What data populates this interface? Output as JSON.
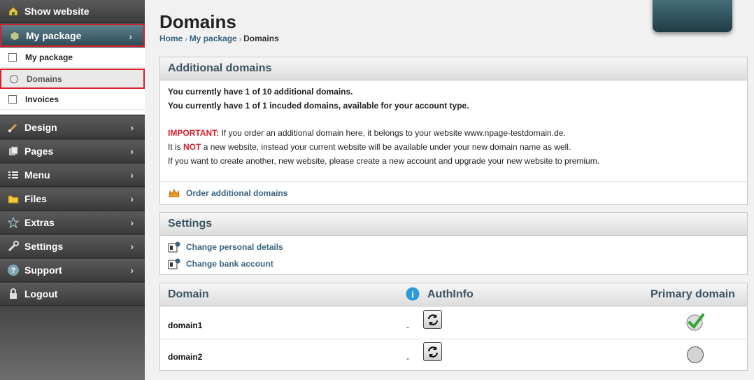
{
  "sidebar": {
    "top_items": [
      {
        "label": "Show website",
        "icon": "house-icon"
      },
      {
        "label": "My package",
        "icon": "package-icon",
        "chevron": "›"
      }
    ],
    "sub_items": [
      {
        "label": "My package",
        "icon": "box-outline-icon"
      },
      {
        "label": "Domains",
        "icon": "globe-icon"
      },
      {
        "label": "Invoices",
        "icon": "invoice-icon"
      }
    ],
    "bottom_items": [
      {
        "label": "Design",
        "icon": "brush-icon",
        "chevron": "›"
      },
      {
        "label": "Pages",
        "icon": "pages-icon",
        "chevron": "›"
      },
      {
        "label": "Menu",
        "icon": "menu-icon",
        "chevron": "›"
      },
      {
        "label": "Files",
        "icon": "folder-icon",
        "chevron": "›"
      },
      {
        "label": "Extras",
        "icon": "star-icon",
        "chevron": "›"
      },
      {
        "label": "Settings",
        "icon": "wrench-icon",
        "chevron": "›"
      },
      {
        "label": "Support",
        "icon": "help-icon",
        "chevron": "›"
      },
      {
        "label": "Logout",
        "icon": "lock-icon"
      }
    ]
  },
  "page": {
    "title": "Domains",
    "breadcrumb": {
      "home": "Home",
      "sep": "›",
      "parent": "My package",
      "current": "Domains"
    }
  },
  "additional": {
    "heading": "Additional domains",
    "line1": "You currently have 1 of 10 additional domains.",
    "line2": "You currently have 1 of 1 incuded domains, available for your account type.",
    "important_label": "IMPORTANT:",
    "important_text": " If you order an additional domain here, it belongs to your website www.npage-testdomain.de.",
    "not_pre": "It is ",
    "not_word": "NOT",
    "not_post": " a new website, instead your current website will be available under your new domain name as well.",
    "line_create": "If you want to create another, new website, please create a new account and upgrade your new website to premium.",
    "order_link": "Order additional domains"
  },
  "settings": {
    "heading": "Settings",
    "link_personal": "Change personal details",
    "link_bank": "Change bank account"
  },
  "domains_table": {
    "col_domain": "Domain",
    "col_authinfo": "AuthInfo",
    "col_primary": "Primary domain",
    "rows": [
      {
        "domain": "domain1",
        "authinfo": "-",
        "primary": true
      },
      {
        "domain": "domain2",
        "authinfo": "-",
        "primary": false
      }
    ]
  },
  "colors": {
    "accent": "#3c5463",
    "highlight": "#d6202a",
    "link": "#3a6480"
  }
}
